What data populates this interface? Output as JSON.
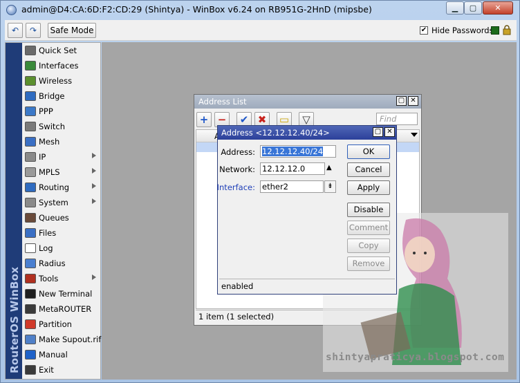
{
  "window": {
    "title": "admin@D4:CA:6D:F2:CD:29 (Shintya) - WinBox v6.24 on RB951G-2HnD (mipsbe)",
    "minimize": "▁",
    "maximize": "▢",
    "close": "✕"
  },
  "toolbar": {
    "undo": "↶",
    "redo": "↷",
    "safe_mode": "Safe Mode",
    "hide_passwords_label": "Hide Passwords",
    "hide_passwords_checked": "✔"
  },
  "sidebar": {
    "brand": "RouterOS WinBox",
    "items": [
      {
        "label": "Quick Set",
        "icon": "quick-set-icon",
        "color": "#6a6a6a",
        "arrow": false
      },
      {
        "label": "Interfaces",
        "icon": "interfaces-icon",
        "color": "#3a8a3a",
        "arrow": false
      },
      {
        "label": "Wireless",
        "icon": "wireless-icon",
        "color": "#5b8f2e",
        "arrow": false
      },
      {
        "label": "Bridge",
        "icon": "bridge-icon",
        "color": "#2e6bc0",
        "arrow": false
      },
      {
        "label": "PPP",
        "icon": "ppp-icon",
        "color": "#3c79c8",
        "arrow": false
      },
      {
        "label": "Switch",
        "icon": "switch-icon",
        "color": "#7a7a7a",
        "arrow": false
      },
      {
        "label": "Mesh",
        "icon": "mesh-icon",
        "color": "#3a6fc4",
        "arrow": false
      },
      {
        "label": "IP",
        "icon": "ip-icon",
        "color": "#8a8a8a",
        "arrow": true
      },
      {
        "label": "MPLS",
        "icon": "mpls-icon",
        "color": "#9a9a9a",
        "arrow": true
      },
      {
        "label": "Routing",
        "icon": "routing-icon",
        "color": "#2e6bc0",
        "arrow": true
      },
      {
        "label": "System",
        "icon": "system-icon",
        "color": "#8a8a8a",
        "arrow": true
      },
      {
        "label": "Queues",
        "icon": "queues-icon",
        "color": "#6a4a3a",
        "arrow": false
      },
      {
        "label": "Files",
        "icon": "files-icon",
        "color": "#3a6fc4",
        "arrow": false
      },
      {
        "label": "Log",
        "icon": "log-icon",
        "color": "#ffffff",
        "arrow": false
      },
      {
        "label": "Radius",
        "icon": "radius-icon",
        "color": "#4a7fd0",
        "arrow": false
      },
      {
        "label": "Tools",
        "icon": "tools-icon",
        "color": "#b03020",
        "arrow": true
      },
      {
        "label": "New Terminal",
        "icon": "terminal-icon",
        "color": "#202020",
        "arrow": false
      },
      {
        "label": "MetaROUTER",
        "icon": "metarouter-icon",
        "color": "#3a3a3a",
        "arrow": false
      },
      {
        "label": "Partition",
        "icon": "partition-icon",
        "color": "#d03a2a",
        "arrow": false
      },
      {
        "label": "Make Supout.rif",
        "icon": "supout-icon",
        "color": "#5080c8",
        "arrow": false
      },
      {
        "label": "Manual",
        "icon": "manual-icon",
        "color": "#1f62c8",
        "arrow": false
      },
      {
        "label": "Exit",
        "icon": "exit-icon",
        "color": "#3a3a3a",
        "arrow": false
      }
    ]
  },
  "address_list": {
    "title": "Address List",
    "restore": "▢",
    "close": "✕",
    "add": "+",
    "remove": "−",
    "enable": "✔",
    "disable": "✖",
    "comment": "▭",
    "filter": "▽",
    "find_placeholder": "Find",
    "column_header_partial": "A",
    "status": "1 item (1 selected)"
  },
  "address_dialog": {
    "title": "Address <12.12.12.40/24>",
    "restore": "▢",
    "close": "✕",
    "address_label": "Address:",
    "address_value": "12.12.12.40/24",
    "network_label": "Network:",
    "network_value": "12.12.12.0",
    "network_arrow": "▲",
    "interface_label": "Interface:",
    "interface_value": "ether2",
    "interface_arrow": "⇟",
    "buttons": {
      "ok": "OK",
      "cancel": "Cancel",
      "apply": "Apply",
      "disable": "Disable",
      "comment": "Comment",
      "copy": "Copy",
      "remove": "Remove"
    },
    "status": "enabled"
  },
  "watermark": {
    "text": "shintyapraticya.blogspot.com"
  }
}
